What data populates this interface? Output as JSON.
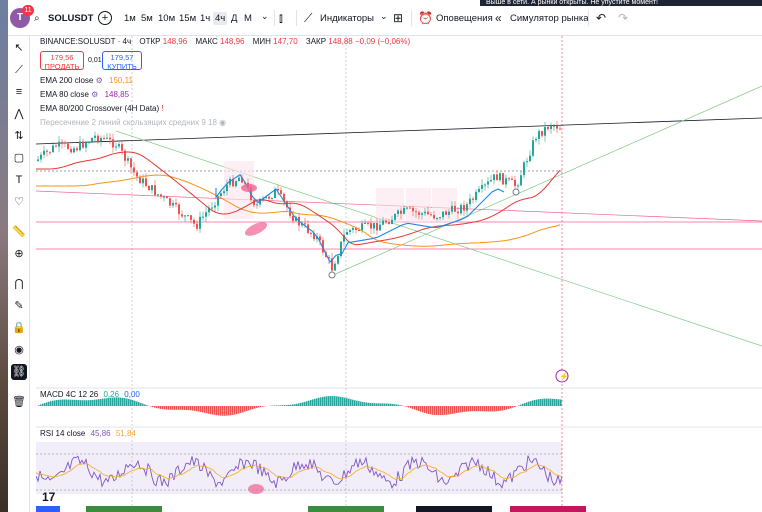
{
  "notification": "Выше в сети. А рынки открыты. Не упустите момент!",
  "user": {
    "initial": "T",
    "badge": "11"
  },
  "symbol": "SOLUSDT",
  "timeframes": [
    "1м",
    "5м",
    "10м",
    "15м",
    "1ч",
    "4ч",
    "Д",
    "М"
  ],
  "active_timeframe": "4ч",
  "toolbar": {
    "indicators": "Индикаторы",
    "alerts": "Оповещения",
    "replay": "Симулятор рынка"
  },
  "legend": {
    "symbol_full": "BINANCE:SOLUSDT · 4ч",
    "open_label": "ОТКР",
    "open": "148,96",
    "high_label": "МАКС",
    "high": "148,96",
    "low_label": "МИН",
    "low": "147,70",
    "close_label": "ЗАКР",
    "close": "148,88",
    "change": "−0,09 (−0,06%)"
  },
  "trade": {
    "sell_price": "179,56",
    "sell_label": "ПРОДАТЬ",
    "spread": "0,01",
    "buy_price": "179,57",
    "buy_label": "КУПИТЬ"
  },
  "indicators": [
    {
      "name": "EMA 200 close",
      "value": "150,11",
      "color": "#f7931a"
    },
    {
      "name": "EMA 80 close",
      "value": "148,85",
      "color": "#9c27b0"
    },
    {
      "name": "EMA 80/200 Crossover (4H Data)",
      "value": "",
      "color": "#131722"
    },
    {
      "name": "Пересечение 2 линий скользящих средних 9 18",
      "value": "",
      "color": "#b2b5be"
    }
  ],
  "macd": {
    "label": "MACD 4C 12 26",
    "v1": "0,26",
    "v2": "0,00"
  },
  "rsi": {
    "label": "RSI 14 close",
    "v1": "45,86",
    "v2": "51,84"
  },
  "logo": "17",
  "colors": {
    "up": "#26a69a",
    "down": "#ef5350",
    "accent": "#2962ff",
    "rsi": "#7e57c2"
  }
}
